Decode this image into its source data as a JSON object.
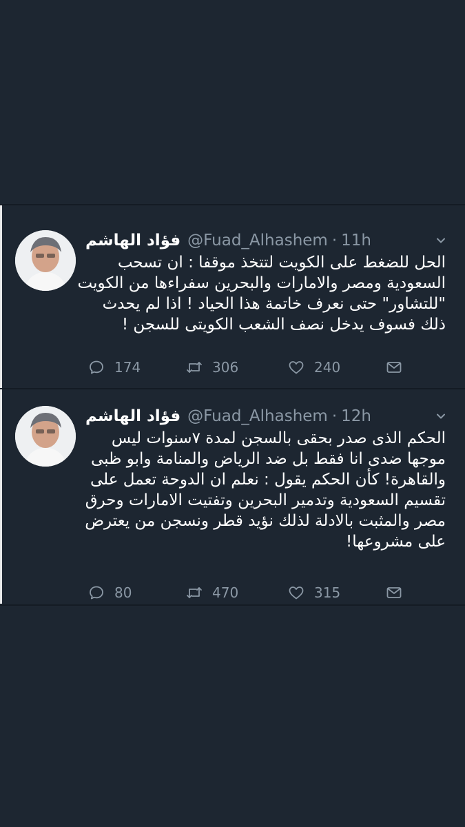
{
  "tweets": [
    {
      "name": "فؤاد الهاشم",
      "handle": "@Fuad_Alhashem",
      "separator": "·",
      "time": "11h",
      "lines": [
        "الحل للضغط على الكويت لتتخذ موقفا : ان تسحب",
        "السعودية ومصر والامارات والبحرين  سفراءها من الكويت",
        "\"للتشاور\"  حتى نعرف  خاتمة هذا الحياد ! اذا لم يحدث",
        "ذلك فسوف يدخل  نصف الشعب الكويتى للسجن !"
      ],
      "replies": "174",
      "retweets": "306",
      "likes": "240"
    },
    {
      "name": "فؤاد الهاشم",
      "handle": "@Fuad_Alhashem",
      "separator": "·",
      "time": "12h",
      "lines": [
        "الحكم الذى صدر  بحقى بالسجن  لمدة ٧سنوات ليس",
        "موجها ضدى انا فقط بل ضد الرياض والمنامة وابو ظبى",
        "والقاهرة! كأن الحكم يقول : نعلم ان الدوحة تعمل على",
        "تقسيم السعودية وتدمير البحرين وتفتيت الامارات وحرق",
        "مصر والمثبت بالادلة لذلك نؤيد قطر ونسجن من يعترض",
        "على مشروعها!"
      ],
      "replies": "80",
      "retweets": "470",
      "likes": "315"
    }
  ],
  "icons": {
    "reply": "reply-icon",
    "retweet": "retweet-icon",
    "like": "heart-icon",
    "message": "envelope-icon",
    "more": "chevron-down-icon"
  },
  "colors": {
    "background": "#1d2631",
    "text": "#ffffff",
    "muted": "#8b98a5"
  }
}
